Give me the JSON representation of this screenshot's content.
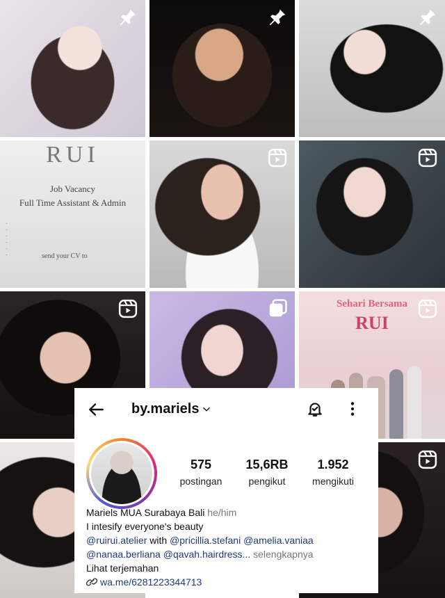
{
  "grid": {
    "tiles": [
      {
        "badge": "pin-icon"
      },
      {
        "badge": "pin-icon"
      },
      {
        "badge": "pin-icon"
      },
      {
        "badge": "none",
        "job": {
          "logo": "RUI",
          "line1": "Job Vacancy",
          "line2": "Full Time Assistant & Admin",
          "footer": "send your CV to"
        }
      },
      {
        "badge": "reels-icon"
      },
      {
        "badge": "reels-icon"
      },
      {
        "badge": "reels-icon"
      },
      {
        "badge": "carousel-icon"
      },
      {
        "badge": "reels-icon",
        "overlay": {
          "line1": "Sehari Bersama",
          "line2": "RUI"
        }
      },
      {
        "badge": "none"
      },
      {
        "badge": "none"
      },
      {
        "badge": "reels-icon"
      }
    ]
  },
  "profile": {
    "username": "by.mariels",
    "stats": [
      {
        "value": "575",
        "label": "postingan"
      },
      {
        "value": "15,6RB",
        "label": "pengikut"
      },
      {
        "value": "1.952",
        "label": "mengikuti"
      }
    ],
    "name": "Mariels MUA Surabaya Bali",
    "pronouns": "he/him",
    "bio_line1": "I intesify everyone's beauty",
    "mentions_line1_a": "@ruirui.atelier",
    "mentions_line1_b": " with ",
    "mentions_line1_c": "@pricillia.stefani @amelia.vaniaa",
    "mentions_line2": "@nanaa.berliana @qavah.hairdress...",
    "more_label": "selengkapnya",
    "translate_label": "Lihat terjemahan",
    "link": "wa.me/6281223344713"
  },
  "colors": {
    "link": "#1f3a7a",
    "muted": "#777777",
    "ring_start": "#f58529",
    "ring_end": "#8134af"
  }
}
